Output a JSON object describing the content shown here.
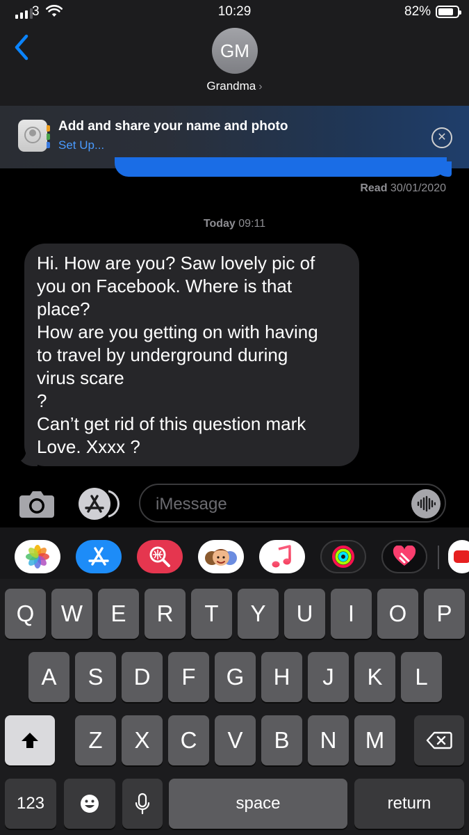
{
  "status_bar": {
    "carrier": "3",
    "time": "10:29",
    "battery": "82%",
    "battery_level": 0.82,
    "signal_bars": 4,
    "signal_bars_filled": 3
  },
  "header": {
    "back_icon": "chevron-left-icon",
    "avatar_initials": "GM",
    "contact_name": "Grandma",
    "contact_chevron": "›"
  },
  "share_banner": {
    "title": "Add and share your name and photo",
    "action": "Set Up...",
    "close_icon": "close-circle-icon"
  },
  "conversation": {
    "read_label": "Read",
    "read_date": "30/01/2020",
    "day_label": "Today",
    "day_time": "09:11",
    "incoming_message": "Hi. How are you?  Saw lovely pic of\nyou on Facebook. Where is that\nplace?\nHow are you getting on with having\nto travel by underground during\nvirus scare\n?\nCan’t get rid of this question mark\nLove. Xxxx ?"
  },
  "compose": {
    "placeholder": "iMessage",
    "camera_icon": "camera-icon",
    "apps_icon": "app-store-icon",
    "audio_icon": "audio-waveform-icon"
  },
  "app_drawer": [
    "photos-app-icon",
    "app-store-app-icon",
    "image-search-app-icon",
    "memoji-stickers-app-icon",
    "music-app-icon",
    "activity-app-icon",
    "digital-touch-app-icon",
    "partial-app-icon"
  ],
  "keyboard": {
    "row1": [
      "Q",
      "W",
      "E",
      "R",
      "T",
      "Y",
      "U",
      "I",
      "O",
      "P"
    ],
    "row2": [
      "A",
      "S",
      "D",
      "F",
      "G",
      "H",
      "J",
      "K",
      "L"
    ],
    "row3": [
      "Z",
      "X",
      "C",
      "V",
      "B",
      "N",
      "M"
    ],
    "numbers": "123",
    "space": "space",
    "return": "return",
    "shift_icon": "shift-icon",
    "delete_icon": "delete-backspace-icon",
    "emoji_icon": "emoji-icon",
    "mic_icon": "microphone-icon"
  },
  "colors": {
    "accent_blue": "#0a84ff",
    "bubble_gray": "#262629",
    "key_gray": "#5c5c5f"
  }
}
